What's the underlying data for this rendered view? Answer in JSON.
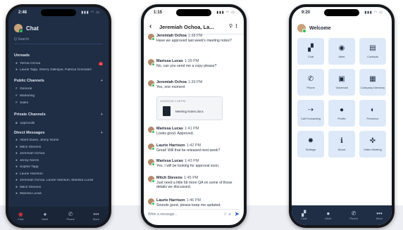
{
  "phone1": {
    "time": "2:48",
    "title": "Chat",
    "search_placeholder": "Q Search",
    "sections": {
      "unreads": "Unreads",
      "public": "Public Channels",
      "private": "Private Channels",
      "direct": "Direct Messages"
    },
    "unreads": [
      {
        "label": "Yerma Ochoa",
        "badge": "1"
      },
      {
        "label": "Laurie Tapp, Sherry Gillespie, Patricia Gonzalez",
        "badge": ""
      }
    ],
    "public_channels": [
      "General",
      "Marketing",
      "Sales"
    ],
    "private_channels": [
      "Approvals"
    ],
    "direct_messages": [
      "Albert Davis, Jenny Norris",
      "Mitch Stevens",
      "Jeremiah Ochoa",
      "Jenny Norris",
      "Sophie Tapp",
      "Laurie Harrison",
      "Jeremiah Ochoa, Laurie Harrison, Marissa Lucas",
      "Mitch Stevens",
      "Marissa Lucas"
    ],
    "nav": [
      {
        "label": "Chat",
        "glyph": "◉",
        "icon": "chat-icon",
        "badge": "1"
      },
      {
        "label": "Meet",
        "glyph": "●",
        "icon": "meet-icon"
      },
      {
        "label": "Phone",
        "glyph": "✆",
        "icon": "phone-icon"
      },
      {
        "label": "More",
        "glyph": "•••",
        "icon": "more-icon"
      }
    ]
  },
  "phone2": {
    "time": "1:15",
    "title": "Jeremiah Ochoa, La...",
    "messages": [
      {
        "name": "Jeremiah Ochoa",
        "time": "1:38 PM",
        "text": "Have we approved last week's meeting notes?"
      },
      {
        "name": "Marissa Lucas",
        "time": "1:39 PM",
        "text": "No, can you send me a copy please?"
      },
      {
        "name": "Jeremiah Ochoa",
        "time": "1:39 PM",
        "text": "Yes, one moment"
      },
      {
        "name": "Marissa Lucas",
        "time": "1:41 PM",
        "text": "Looks good. Approved."
      },
      {
        "name": "Laurie Harrison",
        "time": "1:42 PM",
        "text": "Great! Will that be released next week?"
      },
      {
        "name": "Marissa Lucas",
        "time": "1:43 PM",
        "text": "Yes. I will be looking for approval soon."
      },
      {
        "name": "Mitch Stevens",
        "time": "1:45 PM",
        "text": "Just need a little bit more QA on some of those details we discussed."
      },
      {
        "name": "Laurie Harrison",
        "time": "1:46 PM",
        "text": "Sounds good, please keep me updated."
      }
    ],
    "file": {
      "header": "10/20/2022 1:38 PM",
      "name": "Meeting Notes.docx"
    },
    "input_placeholder": "Write a message..."
  },
  "phone3": {
    "time": "9:20",
    "title": "Welcome",
    "tiles": [
      {
        "label": "Chat",
        "glyph": "▞",
        "icon": "chat-icon"
      },
      {
        "label": "Meet",
        "glyph": "◉",
        "icon": "meet-icon"
      },
      {
        "label": "Contacts",
        "glyph": "▤",
        "icon": "contacts-icon"
      },
      {
        "label": "Phone",
        "glyph": "✆",
        "icon": "phone-icon"
      },
      {
        "label": "Voicemail",
        "glyph": "▣",
        "icon": "voicemail-icon"
      },
      {
        "label": "Company Directory",
        "glyph": "▦",
        "icon": "directory-icon"
      },
      {
        "label": "Call Forwarding",
        "glyph": "⇢",
        "icon": "call-forwarding-icon"
      },
      {
        "label": "Profile",
        "glyph": "●",
        "icon": "profile-icon"
      },
      {
        "label": "Presence",
        "glyph": "◐",
        "icon": "presence-icon"
      },
      {
        "label": "Settings",
        "glyph": "✹",
        "icon": "settings-icon"
      },
      {
        "label": "About",
        "glyph": "ℹ",
        "icon": "about-icon"
      },
      {
        "label": "Video Meeting",
        "glyph": "✜",
        "icon": "video-meeting-icon"
      }
    ],
    "nav": [
      {
        "label": "Chat",
        "glyph": "▞",
        "icon": "chat-icon"
      },
      {
        "label": "Meet",
        "glyph": "●",
        "icon": "meet-icon"
      },
      {
        "label": "Phone",
        "glyph": "✆",
        "icon": "phone-icon"
      },
      {
        "label": "More",
        "glyph": "•••",
        "icon": "more-icon"
      }
    ]
  }
}
